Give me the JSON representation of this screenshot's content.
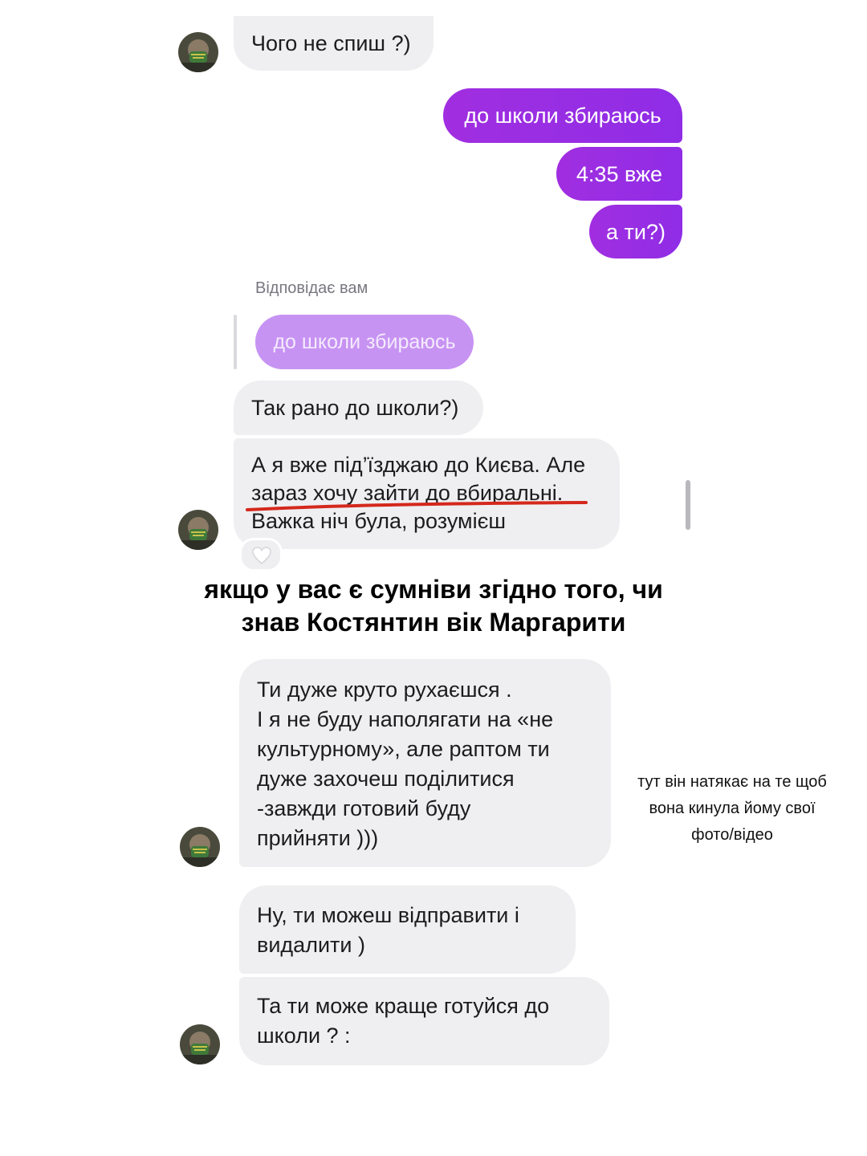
{
  "messages": {
    "m1": "Чого не спиш ?)",
    "m2": "до школи збираюсь",
    "m3": "4:35 вже",
    "m4": "а ти?)",
    "reply_label": "Відповідає вам",
    "quoted": "до школи збираюсь",
    "m5": "Так рано до школи?)",
    "m6": [
      "А я вже під’їзджаю до Києва. Але",
      "зараз хочу зайти до вбиральні.",
      "Важка ніч була, розумієш"
    ],
    "m7": [
      "Ти дуже круто рухаєшся .",
      "І я не буду наполягати на «не",
      "культурному», але раптом ти",
      "дуже захочеш поділитися",
      "-завжди готовий буду",
      "прийняти )))"
    ],
    "m8": [
      "Ну, ти можеш відправити і",
      "видалити )"
    ],
    "m9": [
      "Та ти може краще готуйся до",
      "школи ? :"
    ]
  },
  "caption": [
    "якщо у вас є сумніви згідно того, чи",
    "знав Костянтин вік Маргарити"
  ],
  "side_note": [
    "тут він натякає на те щоб",
    "вона кинула йому свої",
    "фото/відео"
  ],
  "colors": {
    "outgoing_bubble": "#9b2ee3",
    "incoming_bubble": "#efeff1",
    "underline": "#d4281c"
  },
  "icons": {
    "avatar": "avatar-photo",
    "reaction": "heart-icon"
  }
}
